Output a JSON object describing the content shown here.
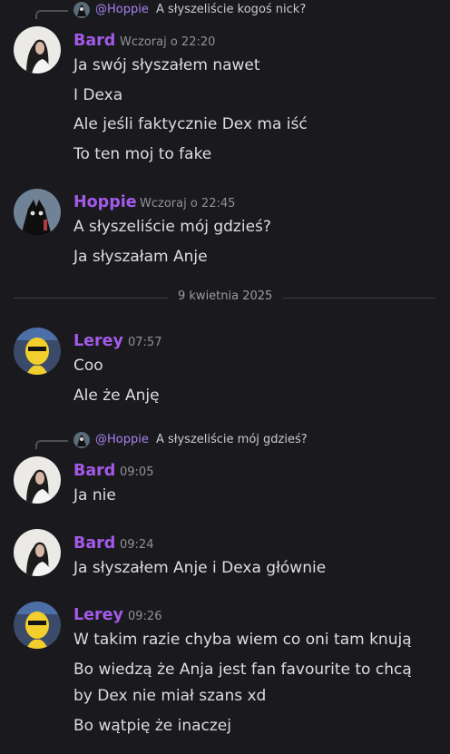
{
  "reply1": {
    "mention": "@Hoppie",
    "text": "A słyszeliście kogoś nick?"
  },
  "reply2": {
    "mention": "@Hoppie",
    "text": "A słyszeliście mój gdzieś?"
  },
  "date_divider": "9 kwietnia 2025",
  "groups": [
    {
      "author": "Bard",
      "time": "Wczoraj o 22:20",
      "messages": [
        "Ja swój słyszałem nawet",
        "I Dexa",
        "Ale jeśli faktycznie Dex ma iść",
        "To ten moj to fake"
      ]
    },
    {
      "author": "Hoppie",
      "time": "Wczoraj o 22:45",
      "messages": [
        "A słyszeliście mój gdzieś?",
        "Ja słyszałam Anje"
      ]
    },
    {
      "author": "Lerey",
      "time": "07:57",
      "messages": [
        "Coo",
        "Ale że Anję"
      ]
    },
    {
      "author": "Bard",
      "time": "09:05",
      "messages": [
        "Ja nie"
      ]
    },
    {
      "author": "Bard",
      "time": "09:24",
      "messages": [
        "Ja słyszałem Anje i Dexa głównie"
      ]
    },
    {
      "author": "Lerey",
      "time": "09:26",
      "messages": [
        "W takim razie chyba wiem co oni tam knują",
        "Bo wiedzą że Anja jest fan favourite to chcą",
        "by Dex nie miał szans xd",
        "Bo wątpię że inaczej"
      ]
    }
  ],
  "colors": {
    "background": "#1a1a1e",
    "author": "#a45ae8",
    "mention": "#a880ee"
  }
}
